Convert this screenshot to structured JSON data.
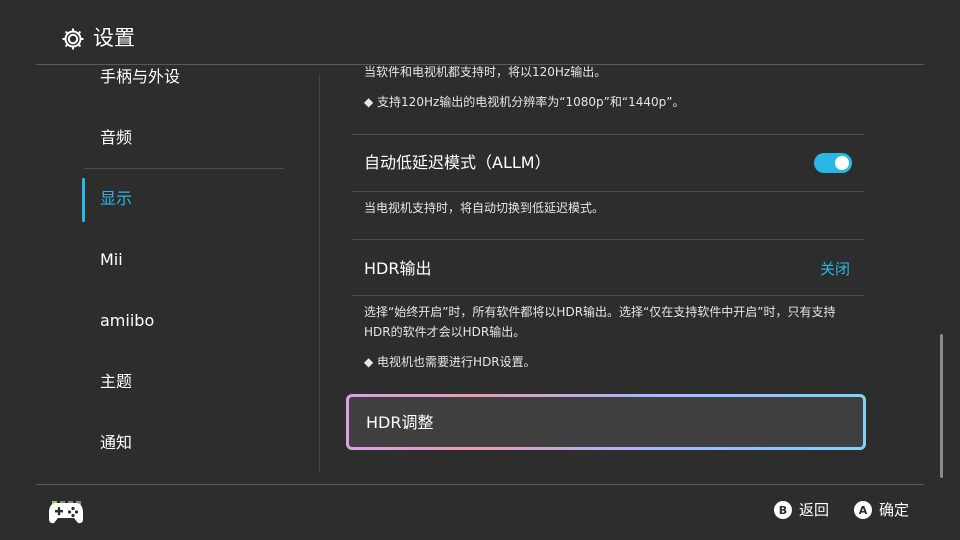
{
  "header": {
    "title": "设置",
    "icon": "gear-icon"
  },
  "sidebar": {
    "items": [
      {
        "label": "手柄与外设",
        "active": false
      },
      {
        "label": "音频",
        "active": false
      },
      {
        "label": "显示",
        "active": true
      },
      {
        "label": "Mii",
        "active": false
      },
      {
        "label": "amiibo",
        "active": false
      },
      {
        "label": "主题",
        "active": false
      },
      {
        "label": "通知",
        "active": false
      }
    ]
  },
  "content": {
    "note_120hz": "当软件和电视机都支持时，将以120Hz输出。",
    "note_120hz_res": "◆ 支持120Hz输出的电视机分辨率为“1080p”和“1440p”。",
    "allm": {
      "label": "自动低延迟模式（ALLM）",
      "enabled": true,
      "description": "当电视机支持时，将自动切换到低延迟模式。"
    },
    "hdr_output": {
      "label": "HDR输出",
      "value": "关闭",
      "description_line1": "选择“始终开启”时，所有软件都将以HDR输出。选择“仅在支持软件中开启”时，只有支持",
      "description_line2": "HDR的软件才会以HDR输出。",
      "note": "◆ 电视机也需要进行HDR设置。"
    },
    "hdr_adjust": {
      "label": "HDR调整"
    }
  },
  "footer": {
    "back": {
      "key": "B",
      "label": "返回"
    },
    "confirm": {
      "key": "A",
      "label": "确定"
    }
  },
  "colors": {
    "accent": "#2ab7e6",
    "background": "#2d2d2d"
  }
}
